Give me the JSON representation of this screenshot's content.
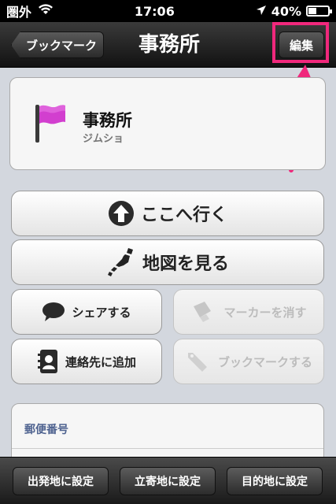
{
  "status": {
    "carrier": "圏外",
    "time": "17:06",
    "battery": "40%",
    "battery_level": 0.4
  },
  "nav": {
    "back_label": "ブックマーク",
    "title": "事務所",
    "edit_label": "編集"
  },
  "place": {
    "name": "事務所",
    "reading": "ジムショ"
  },
  "actions": {
    "go_here": "ここへ行く",
    "view_map": "地図を見る",
    "share": "シェアする",
    "remove_marker": "マーカーを消す",
    "add_contact": "連絡先に追加",
    "bookmark": "ブックマークする"
  },
  "details": {
    "postal_label": "郵便番号"
  },
  "toolbar": {
    "set_origin": "出発地に設定",
    "set_waypoint": "立寄地に設定",
    "set_destination": "目的地に設定"
  },
  "colors": {
    "highlight": "#f0287c",
    "flag": "#d23fcf"
  }
}
